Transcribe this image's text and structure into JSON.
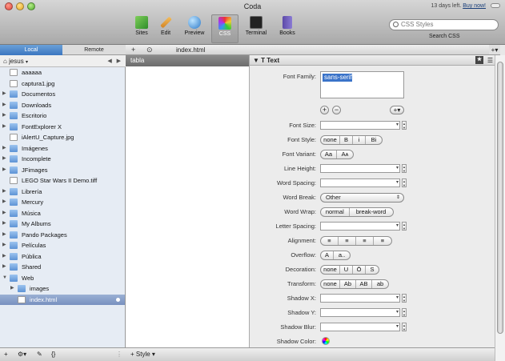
{
  "window": {
    "title": "Coda",
    "trial_text": "13 days left.",
    "buy_now": "Buy now!"
  },
  "toolbar": {
    "buttons": [
      {
        "label": "Sites",
        "icon": "sites-icon"
      },
      {
        "label": "Edit",
        "icon": "pencil-icon"
      },
      {
        "label": "Preview",
        "icon": "globe-icon"
      },
      {
        "label": "CSS",
        "icon": "css-icon"
      },
      {
        "label": "Terminal",
        "icon": "terminal-icon"
      },
      {
        "label": "Books",
        "icon": "books-icon"
      }
    ],
    "active": "CSS",
    "search_placeholder": "CSS Styles",
    "search_label": "Search CSS"
  },
  "sidebar": {
    "tabs": [
      "Local",
      "Remote"
    ],
    "path": "jesus",
    "files": [
      {
        "name": "aaaaaa",
        "kind": "doc",
        "expandable": false
      },
      {
        "name": "captura1.jpg",
        "kind": "doc",
        "expandable": false
      },
      {
        "name": "Documentos",
        "kind": "folder",
        "expandable": true
      },
      {
        "name": "Downloads",
        "kind": "folder",
        "expandable": true
      },
      {
        "name": "Escritorio",
        "kind": "folder",
        "expandable": true
      },
      {
        "name": "FontExplorer X",
        "kind": "folder",
        "expandable": true
      },
      {
        "name": "iAlertU_Capture.jpg",
        "kind": "doc",
        "expandable": false
      },
      {
        "name": "Imágenes",
        "kind": "folder",
        "expandable": true
      },
      {
        "name": "Incomplete",
        "kind": "folder",
        "expandable": true
      },
      {
        "name": "JFimages",
        "kind": "folder",
        "expandable": true
      },
      {
        "name": "LEGO Star Wars II Demo.tiff",
        "kind": "doc",
        "expandable": false
      },
      {
        "name": "Librería",
        "kind": "folder",
        "expandable": true
      },
      {
        "name": "Mercury",
        "kind": "folder",
        "expandable": true
      },
      {
        "name": "Música",
        "kind": "folder",
        "expandable": true
      },
      {
        "name": "My Albums",
        "kind": "folder",
        "expandable": true
      },
      {
        "name": "Pando Packages",
        "kind": "folder",
        "expandable": true
      },
      {
        "name": "Películas",
        "kind": "folder",
        "expandable": true
      },
      {
        "name": "Pública",
        "kind": "folder",
        "expandable": true
      },
      {
        "name": "Shared",
        "kind": "folder",
        "expandable": true
      },
      {
        "name": "Web",
        "kind": "folder",
        "expandable": true,
        "open": true
      },
      {
        "name": "images",
        "kind": "folder",
        "expandable": true,
        "indent": 1
      },
      {
        "name": "index.html",
        "kind": "doc",
        "expandable": false,
        "indent": 1,
        "selected": true
      }
    ]
  },
  "editor": {
    "doc_tab": "index.html",
    "selector": "tabla",
    "style_button": "Style"
  },
  "css_panel": {
    "section": "Text",
    "font_family_label": "Font Family:",
    "font_family_value": "sans-serif",
    "rows": [
      {
        "label": "Font Size:",
        "type": "field"
      },
      {
        "label": "Font Style:",
        "type": "segs",
        "options": [
          "none",
          "B",
          "i",
          "Bi"
        ]
      },
      {
        "label": "Font Variant:",
        "type": "segs",
        "options": [
          "Aa",
          "Aᴀ"
        ]
      },
      {
        "label": "Line Height:",
        "type": "field"
      },
      {
        "label": "Word Spacing:",
        "type": "field"
      },
      {
        "label": "Word Break:",
        "type": "popup",
        "value": "Other"
      },
      {
        "label": "Word Wrap:",
        "type": "segs",
        "options": [
          "normal",
          "break-word"
        ]
      },
      {
        "label": "Letter Spacing:",
        "type": "field"
      },
      {
        "label": "Alignment:",
        "type": "segs",
        "options": [
          "≡",
          "≡",
          "≡",
          "≡"
        ]
      },
      {
        "label": "Overflow:",
        "type": "segs",
        "options": [
          "A",
          "a.."
        ]
      },
      {
        "label": "Decoration:",
        "type": "segs",
        "options": [
          "none",
          "U",
          "Ō",
          "S"
        ]
      },
      {
        "label": "Transform:",
        "type": "segs",
        "options": [
          "none",
          "Ab",
          "AB",
          "ab"
        ]
      },
      {
        "label": "Shadow X:",
        "type": "field"
      },
      {
        "label": "Shadow Y:",
        "type": "field"
      },
      {
        "label": "Shadow Blur:",
        "type": "field"
      },
      {
        "label": "Shadow Color:",
        "type": "color"
      }
    ]
  }
}
